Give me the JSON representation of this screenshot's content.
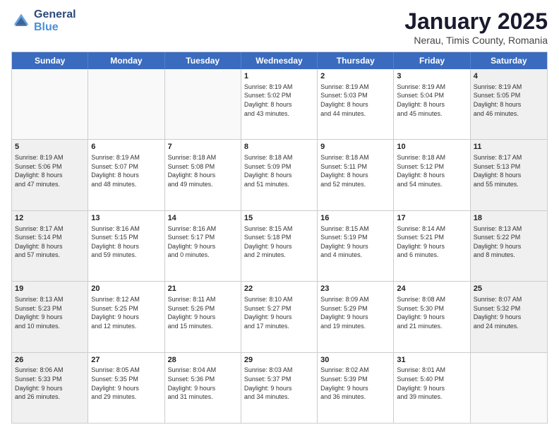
{
  "header": {
    "logo": {
      "general": "General",
      "blue": "Blue"
    },
    "title": "January 2025",
    "subtitle": "Nerau, Timis County, Romania"
  },
  "weekdays": [
    "Sunday",
    "Monday",
    "Tuesday",
    "Wednesday",
    "Thursday",
    "Friday",
    "Saturday"
  ],
  "rows": [
    [
      {
        "day": "",
        "text": "",
        "empty": true
      },
      {
        "day": "",
        "text": "",
        "empty": true
      },
      {
        "day": "",
        "text": "",
        "empty": true
      },
      {
        "day": "1",
        "text": "Sunrise: 8:19 AM\nSunset: 5:02 PM\nDaylight: 8 hours\nand 43 minutes."
      },
      {
        "day": "2",
        "text": "Sunrise: 8:19 AM\nSunset: 5:03 PM\nDaylight: 8 hours\nand 44 minutes."
      },
      {
        "day": "3",
        "text": "Sunrise: 8:19 AM\nSunset: 5:04 PM\nDaylight: 8 hours\nand 45 minutes."
      },
      {
        "day": "4",
        "text": "Sunrise: 8:19 AM\nSunset: 5:05 PM\nDaylight: 8 hours\nand 46 minutes.",
        "shaded": true
      }
    ],
    [
      {
        "day": "5",
        "text": "Sunrise: 8:19 AM\nSunset: 5:06 PM\nDaylight: 8 hours\nand 47 minutes.",
        "shaded": true
      },
      {
        "day": "6",
        "text": "Sunrise: 8:19 AM\nSunset: 5:07 PM\nDaylight: 8 hours\nand 48 minutes."
      },
      {
        "day": "7",
        "text": "Sunrise: 8:18 AM\nSunset: 5:08 PM\nDaylight: 8 hours\nand 49 minutes."
      },
      {
        "day": "8",
        "text": "Sunrise: 8:18 AM\nSunset: 5:09 PM\nDaylight: 8 hours\nand 51 minutes."
      },
      {
        "day": "9",
        "text": "Sunrise: 8:18 AM\nSunset: 5:11 PM\nDaylight: 8 hours\nand 52 minutes."
      },
      {
        "day": "10",
        "text": "Sunrise: 8:18 AM\nSunset: 5:12 PM\nDaylight: 8 hours\nand 54 minutes."
      },
      {
        "day": "11",
        "text": "Sunrise: 8:17 AM\nSunset: 5:13 PM\nDaylight: 8 hours\nand 55 minutes.",
        "shaded": true
      }
    ],
    [
      {
        "day": "12",
        "text": "Sunrise: 8:17 AM\nSunset: 5:14 PM\nDaylight: 8 hours\nand 57 minutes.",
        "shaded": true
      },
      {
        "day": "13",
        "text": "Sunrise: 8:16 AM\nSunset: 5:15 PM\nDaylight: 8 hours\nand 59 minutes."
      },
      {
        "day": "14",
        "text": "Sunrise: 8:16 AM\nSunset: 5:17 PM\nDaylight: 9 hours\nand 0 minutes."
      },
      {
        "day": "15",
        "text": "Sunrise: 8:15 AM\nSunset: 5:18 PM\nDaylight: 9 hours\nand 2 minutes."
      },
      {
        "day": "16",
        "text": "Sunrise: 8:15 AM\nSunset: 5:19 PM\nDaylight: 9 hours\nand 4 minutes."
      },
      {
        "day": "17",
        "text": "Sunrise: 8:14 AM\nSunset: 5:21 PM\nDaylight: 9 hours\nand 6 minutes."
      },
      {
        "day": "18",
        "text": "Sunrise: 8:13 AM\nSunset: 5:22 PM\nDaylight: 9 hours\nand 8 minutes.",
        "shaded": true
      }
    ],
    [
      {
        "day": "19",
        "text": "Sunrise: 8:13 AM\nSunset: 5:23 PM\nDaylight: 9 hours\nand 10 minutes.",
        "shaded": true
      },
      {
        "day": "20",
        "text": "Sunrise: 8:12 AM\nSunset: 5:25 PM\nDaylight: 9 hours\nand 12 minutes."
      },
      {
        "day": "21",
        "text": "Sunrise: 8:11 AM\nSunset: 5:26 PM\nDaylight: 9 hours\nand 15 minutes."
      },
      {
        "day": "22",
        "text": "Sunrise: 8:10 AM\nSunset: 5:27 PM\nDaylight: 9 hours\nand 17 minutes."
      },
      {
        "day": "23",
        "text": "Sunrise: 8:09 AM\nSunset: 5:29 PM\nDaylight: 9 hours\nand 19 minutes."
      },
      {
        "day": "24",
        "text": "Sunrise: 8:08 AM\nSunset: 5:30 PM\nDaylight: 9 hours\nand 21 minutes."
      },
      {
        "day": "25",
        "text": "Sunrise: 8:07 AM\nSunset: 5:32 PM\nDaylight: 9 hours\nand 24 minutes.",
        "shaded": true
      }
    ],
    [
      {
        "day": "26",
        "text": "Sunrise: 8:06 AM\nSunset: 5:33 PM\nDaylight: 9 hours\nand 26 minutes.",
        "shaded": true
      },
      {
        "day": "27",
        "text": "Sunrise: 8:05 AM\nSunset: 5:35 PM\nDaylight: 9 hours\nand 29 minutes."
      },
      {
        "day": "28",
        "text": "Sunrise: 8:04 AM\nSunset: 5:36 PM\nDaylight: 9 hours\nand 31 minutes."
      },
      {
        "day": "29",
        "text": "Sunrise: 8:03 AM\nSunset: 5:37 PM\nDaylight: 9 hours\nand 34 minutes."
      },
      {
        "day": "30",
        "text": "Sunrise: 8:02 AM\nSunset: 5:39 PM\nDaylight: 9 hours\nand 36 minutes."
      },
      {
        "day": "31",
        "text": "Sunrise: 8:01 AM\nSunset: 5:40 PM\nDaylight: 9 hours\nand 39 minutes."
      },
      {
        "day": "",
        "text": "",
        "empty": true
      }
    ]
  ]
}
